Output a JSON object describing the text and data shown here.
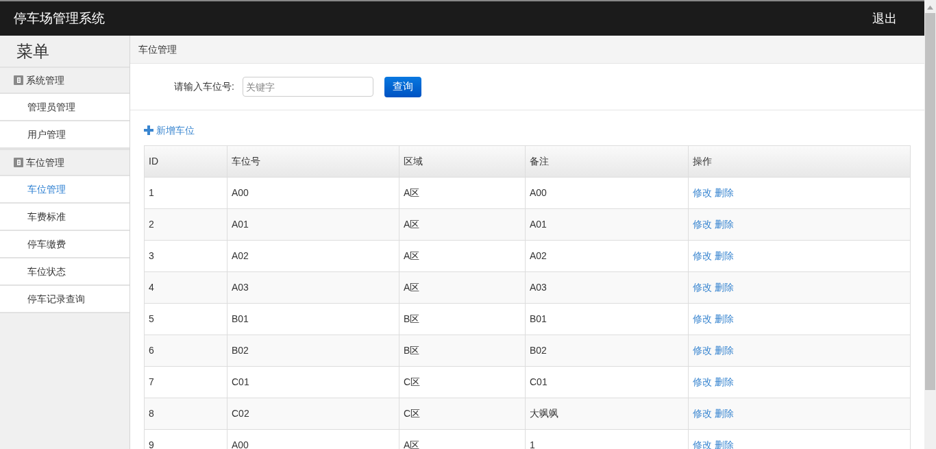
{
  "header": {
    "title": "停车场管理系统",
    "logout": "退出"
  },
  "sidebar": {
    "title": "菜单",
    "groups": [
      {
        "label": "系统管理",
        "items": [
          {
            "label": "管理员管理",
            "selected": false
          },
          {
            "label": "用户管理",
            "selected": false
          }
        ]
      },
      {
        "label": "车位管理",
        "items": [
          {
            "label": "车位管理",
            "selected": true
          },
          {
            "label": "车费标准",
            "selected": false
          },
          {
            "label": "停车缴费",
            "selected": false
          },
          {
            "label": "车位状态",
            "selected": false
          },
          {
            "label": "停车记录查询",
            "selected": false
          }
        ]
      }
    ]
  },
  "breadcrumb": "车位管理",
  "search": {
    "label": "请输入车位号:",
    "placeholder": "关键字",
    "button": "查询"
  },
  "add_link": "新增车位",
  "table": {
    "columns": [
      "ID",
      "车位号",
      "区域",
      "备注",
      "操作"
    ],
    "rows": [
      {
        "cells": [
          "1",
          "A00",
          "A区",
          "A00"
        ],
        "actions": [
          "修改",
          "删除"
        ]
      },
      {
        "cells": [
          "2",
          "A01",
          "A区",
          "A01"
        ],
        "actions": [
          "修改",
          "删除"
        ]
      },
      {
        "cells": [
          "3",
          "A02",
          "A区",
          "A02"
        ],
        "actions": [
          "修改",
          "删除"
        ]
      },
      {
        "cells": [
          "4",
          "A03",
          "A区",
          "A03"
        ],
        "actions": [
          "修改",
          "删除"
        ]
      },
      {
        "cells": [
          "5",
          "B01",
          "B区",
          "B01"
        ],
        "actions": [
          "修改",
          "删除"
        ]
      },
      {
        "cells": [
          "6",
          "B02",
          "B区",
          "B02"
        ],
        "actions": [
          "修改",
          "删除"
        ]
      },
      {
        "cells": [
          "7",
          "C01",
          "C区",
          "C01"
        ],
        "actions": [
          "修改",
          "删除"
        ]
      },
      {
        "cells": [
          "8",
          "C02",
          "C区",
          "大飒飒"
        ],
        "actions": [
          "修改",
          "删除"
        ]
      },
      {
        "cells": [
          "9",
          "A00",
          "A区",
          "1"
        ],
        "actions": [
          "修改",
          "删除"
        ]
      }
    ]
  }
}
